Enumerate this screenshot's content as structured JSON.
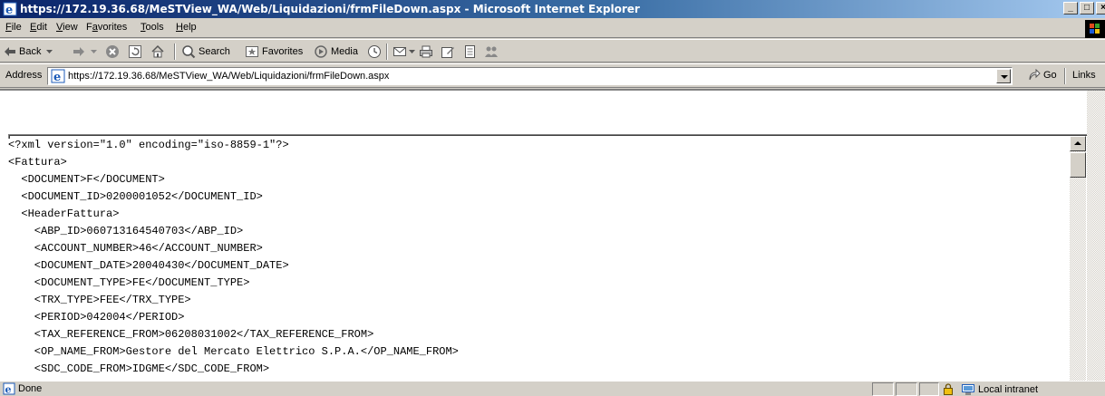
{
  "window": {
    "title": "https://172.19.36.68/MeSTView_WA/Web/Liquidazioni/frmFileDown.aspx - Microsoft Internet Explorer"
  },
  "menu": [
    {
      "label": "File",
      "accel": "F"
    },
    {
      "label": "Edit",
      "accel": "E"
    },
    {
      "label": "View",
      "accel": "V"
    },
    {
      "label": "Favorites",
      "accel": "a"
    },
    {
      "label": "Tools",
      "accel": "T"
    },
    {
      "label": "Help",
      "accel": "H"
    }
  ],
  "toolbar": {
    "back_label": "Back",
    "search_label": "Search",
    "favorites_label": "Favorites",
    "media_label": "Media"
  },
  "address": {
    "label": "Address",
    "url": "https://172.19.36.68/MeSTView_WA/Web/Liquidazioni/frmFileDown.aspx",
    "go_label": "Go",
    "links_label": "Links"
  },
  "xml_lines": [
    "<?xml version=\"1.0\" encoding=\"iso-8859-1\"?>",
    "<Fattura>",
    "  <DOCUMENT>F</DOCUMENT>",
    "  <DOCUMENT_ID>0200001052</DOCUMENT_ID>",
    "  <HeaderFattura>",
    "    <ABP_ID>060713164540703</ABP_ID>",
    "    <ACCOUNT_NUMBER>46</ACCOUNT_NUMBER>",
    "    <DOCUMENT_DATE>20040430</DOCUMENT_DATE>",
    "    <DOCUMENT_TYPE>FE</DOCUMENT_TYPE>",
    "    <TRX_TYPE>FEE</TRX_TYPE>",
    "    <PERIOD>042004</PERIOD>",
    "    <TAX_REFERENCE_FROM>06208031002</TAX_REFERENCE_FROM>",
    "    <OP_NAME_FROM>Gestore del Mercato Elettrico S.P.A.</OP_NAME_FROM>",
    "    <SDC_CODE_FROM>IDGME</SDC_CODE_FROM>"
  ],
  "status": {
    "text": "Done",
    "zone": "Local intranet"
  }
}
